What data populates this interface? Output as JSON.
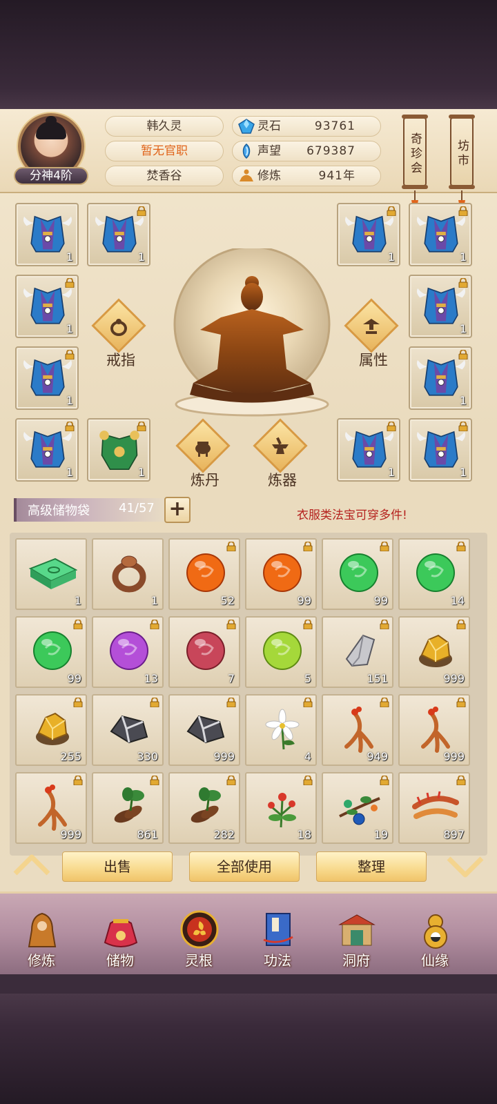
{
  "player": {
    "rank": "分神4阶",
    "name": "韩久灵",
    "official_title": "暂无官职",
    "sect": "焚香谷"
  },
  "stats": {
    "spirit_stone_label": "灵石",
    "spirit_stone_value": "93761",
    "reputation_label": "声望",
    "reputation_value": "679387",
    "cultivation_label": "修炼",
    "cultivation_value": "941年"
  },
  "side_buttons": {
    "treasure_shop": "奇珍会",
    "market": "坊市"
  },
  "equipment": {
    "ring_label": "戒指",
    "attributes_label": "属性",
    "alchemy_label": "炼丹",
    "forging_label": "炼器",
    "slot_qty": "1"
  },
  "bag": {
    "title": "高级储物袋",
    "capacity": "41/57",
    "tip": "衣服类法宝可穿多件!",
    "items": [
      {
        "icon": "jade-book-icon",
        "qty": "1",
        "locked": false
      },
      {
        "icon": "ring-icon",
        "qty": "1",
        "locked": false
      },
      {
        "icon": "orange-orb-icon",
        "qty": "52",
        "locked": true
      },
      {
        "icon": "orange-orb-icon",
        "qty": "99",
        "locked": true
      },
      {
        "icon": "green-orb-icon",
        "qty": "99",
        "locked": true
      },
      {
        "icon": "green-orb-icon",
        "qty": "14",
        "locked": true
      },
      {
        "icon": "green-orb-icon",
        "qty": "99",
        "locked": true
      },
      {
        "icon": "purple-orb-icon",
        "qty": "13",
        "locked": true
      },
      {
        "icon": "red-orb-icon",
        "qty": "7",
        "locked": true
      },
      {
        "icon": "lime-orb-icon",
        "qty": "5",
        "locked": true
      },
      {
        "icon": "silver-ore-icon",
        "qty": "151",
        "locked": true
      },
      {
        "icon": "gold-ore-icon",
        "qty": "999",
        "locked": true
      },
      {
        "icon": "gold-ore-icon",
        "qty": "255",
        "locked": true
      },
      {
        "icon": "iron-ore-icon",
        "qty": "330",
        "locked": true
      },
      {
        "icon": "iron-ore-icon",
        "qty": "999",
        "locked": true
      },
      {
        "icon": "white-flower-icon",
        "qty": "4",
        "locked": true
      },
      {
        "icon": "ginseng-icon",
        "qty": "949",
        "locked": true
      },
      {
        "icon": "ginseng-icon",
        "qty": "999",
        "locked": true
      },
      {
        "icon": "ginseng-icon",
        "qty": "999",
        "locked": true
      },
      {
        "icon": "herb-root-icon",
        "qty": "861",
        "locked": true
      },
      {
        "icon": "herb-root-icon",
        "qty": "282",
        "locked": true
      },
      {
        "icon": "red-flower-herb-icon",
        "qty": "18",
        "locked": true
      },
      {
        "icon": "berry-branch-icon",
        "qty": "19",
        "locked": true
      },
      {
        "icon": "cordyceps-icon",
        "qty": "897",
        "locked": true
      }
    ]
  },
  "actions": {
    "sell": "出售",
    "use_all": "全部使用",
    "sort": "整理"
  },
  "nav": [
    {
      "icon": "cultivator-icon",
      "label": "修炼"
    },
    {
      "icon": "pouch-icon",
      "label": "储物"
    },
    {
      "icon": "spirit-root-icon",
      "label": "灵根"
    },
    {
      "icon": "scripture-icon",
      "label": "功法"
    },
    {
      "icon": "cave-mansion-icon",
      "label": "洞府"
    },
    {
      "icon": "fate-gourd-icon",
      "label": "仙缘"
    }
  ],
  "colors": {
    "accent_orange": "#e0641a",
    "tip_red": "#b5221e",
    "panel_bg": "#eadbbe"
  }
}
